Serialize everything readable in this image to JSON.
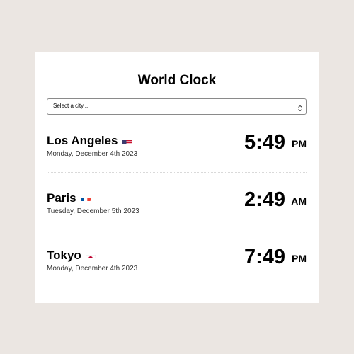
{
  "app": {
    "title": "World Clock"
  },
  "city_select": {
    "placeholder": "Select a city..."
  },
  "clocks": [
    {
      "city": "Los Angeles",
      "flag": "us-flag-icon",
      "date": "Monday, December 4th 2023",
      "time": "5:49",
      "period": "PM"
    },
    {
      "city": "Paris",
      "flag": "fr-flag-icon",
      "date": "Tuesday, December 5th 2023",
      "time": "2:49",
      "period": "AM"
    },
    {
      "city": "Tokyo",
      "flag": "jp-flag-icon",
      "date": "Monday, December 4th 2023",
      "time": "7:49",
      "period": "PM"
    }
  ],
  "colors": {
    "page_background": "#ebe6e2",
    "card_background": "#ffffff",
    "text": "#000000"
  }
}
